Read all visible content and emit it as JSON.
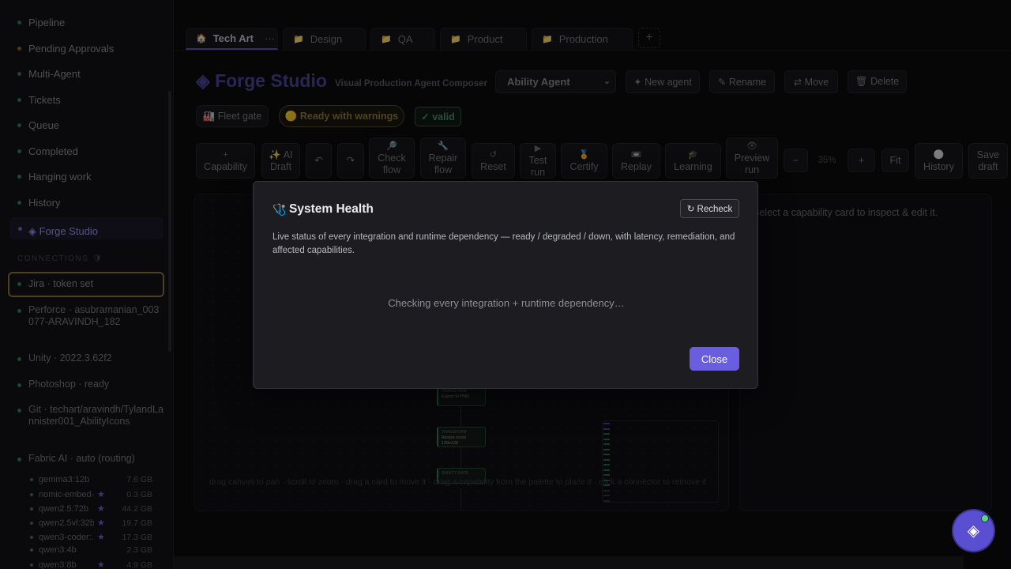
{
  "sidebar": {
    "nav": [
      {
        "label": "Pipeline",
        "dot": "green"
      },
      {
        "label": "Pending Approvals",
        "dot": "amber"
      },
      {
        "label": "Multi-Agent",
        "dot": "green"
      },
      {
        "label": "Tickets",
        "dot": "green"
      },
      {
        "label": "Queue",
        "dot": "green"
      },
      {
        "label": "Completed",
        "dot": "green"
      },
      {
        "label": "Hanging work",
        "dot": "green"
      },
      {
        "label": "History",
        "dot": "green"
      },
      {
        "label": "◈ Forge Studio",
        "dot": "purple",
        "active": true
      }
    ],
    "connections_heading": "CONNECTIONS 🛡",
    "connections": [
      {
        "label": "Jira · token set"
      },
      {
        "label": "Perforce · asubramanian_003077-ARAVINDH_182"
      },
      {
        "label": "Unity · 2022.3.62f2"
      },
      {
        "label": "Photoshop · ready"
      },
      {
        "label": "Git · techart/aravindh/TylandLannister001_AbilityIcons"
      },
      {
        "label": "Fabric AI · auto (routing)"
      }
    ],
    "models": [
      {
        "name": "gemma3:12b",
        "starred": false,
        "size": "7.6 GB"
      },
      {
        "name": "nomic-embed-t...",
        "starred": true,
        "size": "0.3 GB"
      },
      {
        "name": "qwen2.5:72b",
        "starred": true,
        "size": "44.2 GB"
      },
      {
        "name": "qwen2.5vl:32b",
        "starred": true,
        "size": "19.7 GB"
      },
      {
        "name": "qwen3-coder:...",
        "starred": true,
        "size": "17.3 GB"
      },
      {
        "name": "qwen3:4b",
        "starred": false,
        "size": "2.3 GB"
      },
      {
        "name": "qwen3:8b",
        "starred": true,
        "size": "4.9 GB"
      }
    ]
  },
  "tabs": [
    {
      "icon": "🏠",
      "label": "Tech Art",
      "extra": "···",
      "active": true
    },
    {
      "icon": "📁",
      "label": "Design"
    },
    {
      "icon": "📁",
      "label": "QA"
    },
    {
      "icon": "📁",
      "label": "Product"
    },
    {
      "icon": "📁",
      "label": "Production"
    }
  ],
  "tab_add": "+",
  "header": {
    "brand": "◈ Forge Studio",
    "subtitle": "Visual Production Agent Composer",
    "agent_select": "Ability Agent",
    "actions": [
      "✦ New agent",
      "✎ Rename",
      "⇄ Move",
      "🗑 Delete"
    ]
  },
  "status": {
    "fleet_gate": "🏭 Fleet gate",
    "ready": "🟡 Ready with warnings",
    "valid": "✓ valid"
  },
  "toolbar": [
    {
      "icon": "+",
      "label": "Capability"
    },
    {
      "icon": "",
      "label": "✨ AI Draft"
    },
    {
      "icon": "",
      "label": "↶"
    },
    {
      "icon": "",
      "label": "↷"
    },
    {
      "icon": "🔎",
      "label": "Check flow"
    },
    {
      "icon": "🔧",
      "label": "Repair flow"
    },
    {
      "icon": "↺",
      "label": "Reset"
    },
    {
      "icon": "▶",
      "label": "Test run"
    },
    {
      "icon": "🏅",
      "label": "Certify"
    },
    {
      "icon": "📼",
      "label": "Replay"
    },
    {
      "icon": "🎓",
      "label": "Learning"
    },
    {
      "icon": "👁",
      "label": "Preview run"
    },
    {
      "icon": "",
      "label": "−"
    },
    {
      "icon": "",
      "label": "+"
    },
    {
      "icon": "",
      "label": "Fit"
    },
    {
      "icon": "⚪",
      "label": "History"
    },
    {
      "icon": "",
      "label": "Save draft"
    }
  ],
  "zoom_level": "35%",
  "canvas": {
    "hint": "drag canvas to pan · scroll to zoom · drag a card to move it · drag a capability from the palette to place it · click a connector to remove it",
    "nodes": [
      {
        "kind": "TRANSFORM",
        "label": "Export to PNG"
      },
      {
        "kind": "TRANSFORM",
        "label": "Resize icons 128x128"
      },
      {
        "kind": "SAFETY GATE",
        "label": ""
      }
    ]
  },
  "inspector_hint": "Select a capability card to inspect & edit it.",
  "modal": {
    "icon": "🩺",
    "title": "System Health",
    "recheck": "↻ Recheck",
    "description": "Live status of every integration and runtime dependency — ready / degraded / down, with latency, remediation, and affected capabilities.",
    "status": "Checking every integration + runtime dependency…",
    "close": "Close"
  },
  "fab_icon": "◈"
}
